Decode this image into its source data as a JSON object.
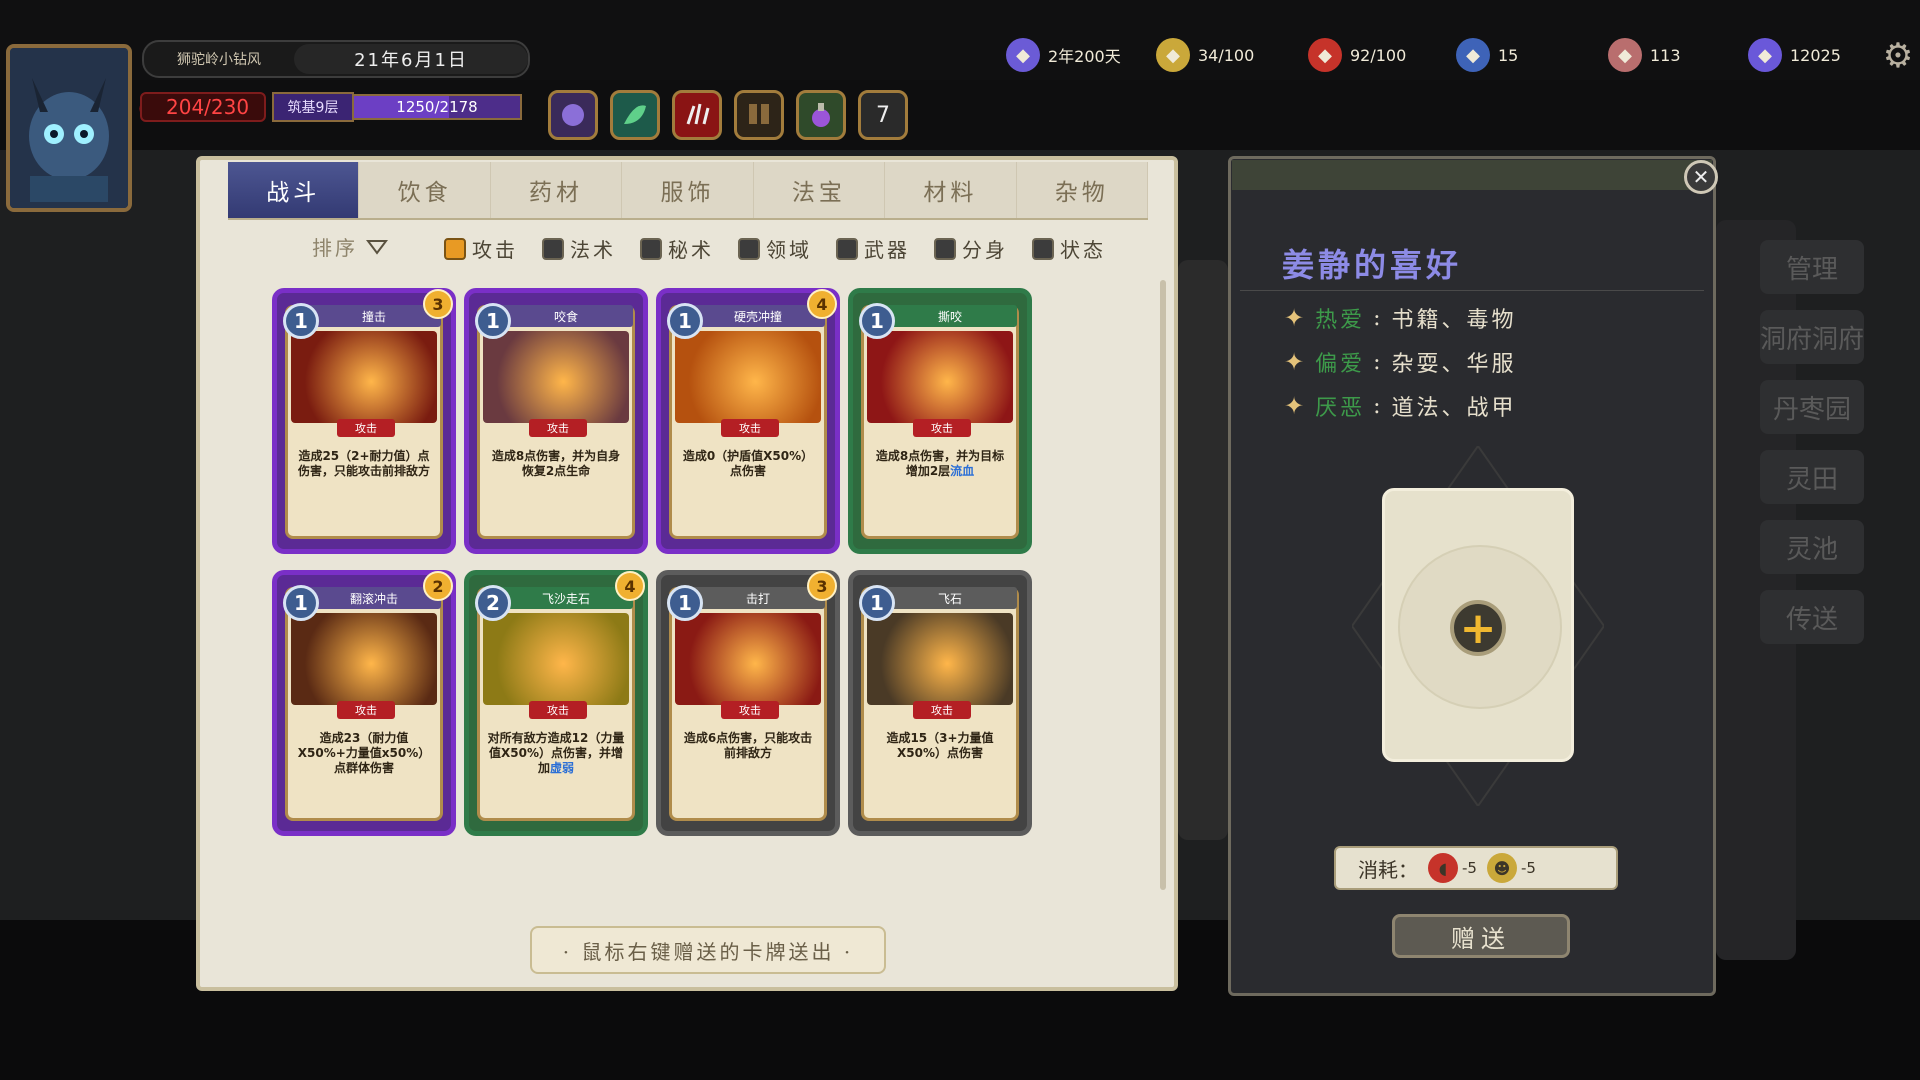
{
  "header": {
    "character_name": "狮驼岭小钻风",
    "date": "21年6月1日",
    "hp": "204/230",
    "realm": "筑基9层",
    "exp": "1250/2178",
    "exp_fraction": 0.574,
    "buff_count": "7"
  },
  "resources": [
    {
      "name": "lifespan",
      "icon": "candle-icon",
      "value": "2年200天",
      "color": "#6b5bd6"
    },
    {
      "name": "disciples",
      "icon": "person-icon",
      "value": "34/100",
      "color": "#caa83a"
    },
    {
      "name": "food",
      "icon": "meat-icon",
      "value": "92/100",
      "color": "#c6332a"
    },
    {
      "name": "reputation",
      "icon": "flag-icon",
      "value": "15",
      "color": "#3e63b8"
    },
    {
      "name": "materials",
      "icon": "rock-icon",
      "value": "113",
      "color": "#b96e6e"
    },
    {
      "name": "spirit-stones",
      "icon": "crystal-icon",
      "value": "12025",
      "color": "#6a58d9"
    }
  ],
  "tabs": [
    "战斗",
    "饮食",
    "药材",
    "服饰",
    "法宝",
    "材料",
    "杂物"
  ],
  "active_tab": 0,
  "sort_label": "排序",
  "filters": [
    {
      "label": "攻击",
      "checked": true
    },
    {
      "label": "法术",
      "checked": false
    },
    {
      "label": "秘术",
      "checked": false
    },
    {
      "label": "领域",
      "checked": false
    },
    {
      "label": "武器",
      "checked": false
    },
    {
      "label": "分身",
      "checked": false
    },
    {
      "label": "状态",
      "checked": false
    }
  ],
  "cards": [
    {
      "title": "撞击",
      "cost": "1",
      "badge": "3",
      "tag": "攻击",
      "rarity": "purple",
      "desc": "造成25（2+耐力值）点伤害，只能攻击前排敌方",
      "art": "#7a1c10"
    },
    {
      "title": "咬食",
      "cost": "1",
      "badge": "",
      "tag": "攻击",
      "rarity": "purple",
      "desc": "造成8点伤害，并为自身恢复2点生命",
      "art": "#6a3a40"
    },
    {
      "title": "硬壳冲撞",
      "cost": "1",
      "badge": "4",
      "tag": "攻击",
      "rarity": "purple",
      "desc": "造成0（护盾值X50%）点伤害",
      "art": "#b5510f"
    },
    {
      "title": "撕咬",
      "cost": "1",
      "badge": "",
      "tag": "攻击",
      "rarity": "green",
      "desc": "造成8点伤害，并为目标增加2层",
      "kw": "流血",
      "art": "#8e1616"
    },
    {
      "title": "翻滚冲击",
      "cost": "1",
      "badge": "2",
      "tag": "攻击",
      "rarity": "purple",
      "desc": "造成23（耐力值X50%+力量值x50%）点群体伤害",
      "art": "#5a2a14"
    },
    {
      "title": "飞沙走石",
      "cost": "2",
      "badge": "4",
      "tag": "攻击",
      "rarity": "green",
      "desc": "对所有敌方造成12（力量值X50%）点伤害，并增加",
      "kw": "虚弱",
      "art": "#8d7a16"
    },
    {
      "title": "击打",
      "cost": "1",
      "badge": "3",
      "tag": "攻击",
      "rarity": "gray",
      "desc": "造成6点伤害，只能攻击前排敌方",
      "art": "#8a1a14"
    },
    {
      "title": "飞石",
      "cost": "1",
      "badge": "",
      "tag": "攻击",
      "rarity": "gray",
      "desc": "造成15（3+力量值X50%）点伤害",
      "art": "#4a3a26"
    }
  ],
  "hint": "· 鼠标右键赠送的卡牌送出 ·",
  "gift_panel": {
    "title": "姜静的喜好",
    "prefs": [
      {
        "label": "热爱",
        "sep": ":",
        "value": "书籍、毒物"
      },
      {
        "label": "偏爱",
        "sep": ":",
        "value": "杂耍、华服"
      },
      {
        "label": "厌恶",
        "sep": ":",
        "value": "道法、战甲"
      }
    ],
    "cost_label": "消耗：",
    "costs": [
      {
        "icon": "meat-icon",
        "value": "-5"
      },
      {
        "icon": "person-icon",
        "value": "-5"
      }
    ],
    "give_label": "赠送"
  },
  "background": {
    "buttons": [
      "管理",
      "洞府洞府",
      "丹枣园",
      "灵田",
      "灵池",
      "传送"
    ]
  }
}
